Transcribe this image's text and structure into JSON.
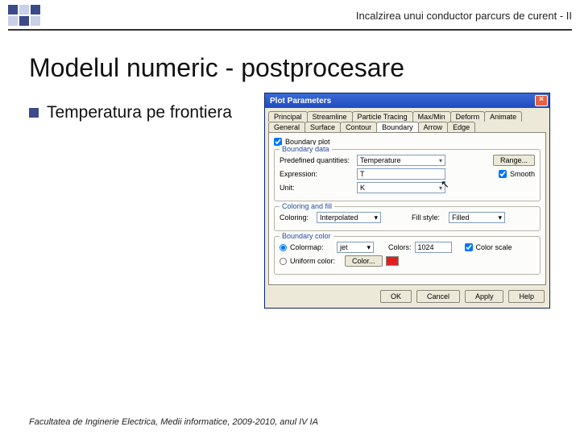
{
  "header": {
    "title": "Incalzirea unui conductor parcurs de curent - II"
  },
  "main_title": "Modelul numeric - postprocesare",
  "bullet": {
    "text": "Temperatura pe frontiera"
  },
  "footer": "Facultatea de Inginerie Electrica, Medii informatice, 2009-2010, anul IV IA",
  "dialog": {
    "title": "Plot Parameters",
    "close": "×",
    "tabs_row1": [
      "Principal",
      "Streamline",
      "Particle Tracing",
      "Max/Min",
      "Deform",
      "Animate"
    ],
    "tabs_row2": [
      "General",
      "Surface",
      "Contour",
      "Boundary",
      "Arrow",
      "Edge"
    ],
    "active_tab": "Boundary",
    "boundary_plot_label": "Boundary plot",
    "boundary_data": {
      "legend": "Boundary data",
      "predef_label": "Predefined quantities:",
      "predef_value": "Temperature",
      "range_btn": "Range...",
      "expr_label": "Expression:",
      "expr_value": "T",
      "smooth_label": "Smooth",
      "unit_label": "Unit:",
      "unit_value": "K"
    },
    "coloring": {
      "legend": "Coloring and fill",
      "coloring_label": "Coloring:",
      "coloring_value": "Interpolated",
      "fill_label": "Fill style:",
      "fill_value": "Filled"
    },
    "bcolor": {
      "legend": "Boundary color",
      "colormap_label": "Colormap:",
      "colormap_value": "jet",
      "colors_label": "Colors:",
      "colors_value": "1024",
      "colorscale_label": "Color scale",
      "uniform_label": "Uniform color:",
      "color_btn": "Color..."
    },
    "buttons": {
      "ok": "OK",
      "cancel": "Cancel",
      "apply": "Apply",
      "help": "Help"
    }
  }
}
